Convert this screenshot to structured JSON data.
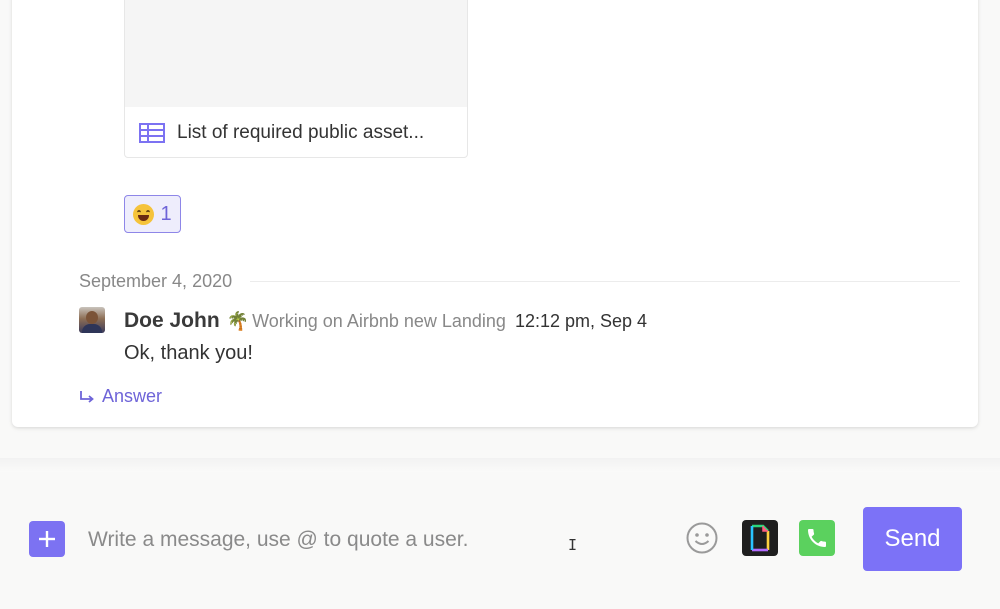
{
  "thread": {
    "attachment": {
      "icon": "table-icon",
      "label": "List of required public asset..."
    },
    "reaction": {
      "emoji": "grinning-face-icon",
      "count": "1"
    },
    "date_divider": "September 4, 2020",
    "message": {
      "author": "Doe John",
      "status_emoji": "🌴",
      "status_text": "Working on Airbnb new Landing",
      "time": "12:12 pm, Sep 4",
      "body": "Ok, thank you!",
      "answer_label": "Answer"
    }
  },
  "composer": {
    "add_icon": "plus-icon",
    "placeholder": "Write a message, use @ to quote a user.",
    "emoji_icon": "smiley-icon",
    "gif_icon": "gif-icon",
    "call_icon": "phone-icon",
    "send_label": "Send"
  },
  "colors": {
    "accent": "#7c72f2",
    "call_green": "#5bd15e",
    "muted_text": "#888888"
  }
}
